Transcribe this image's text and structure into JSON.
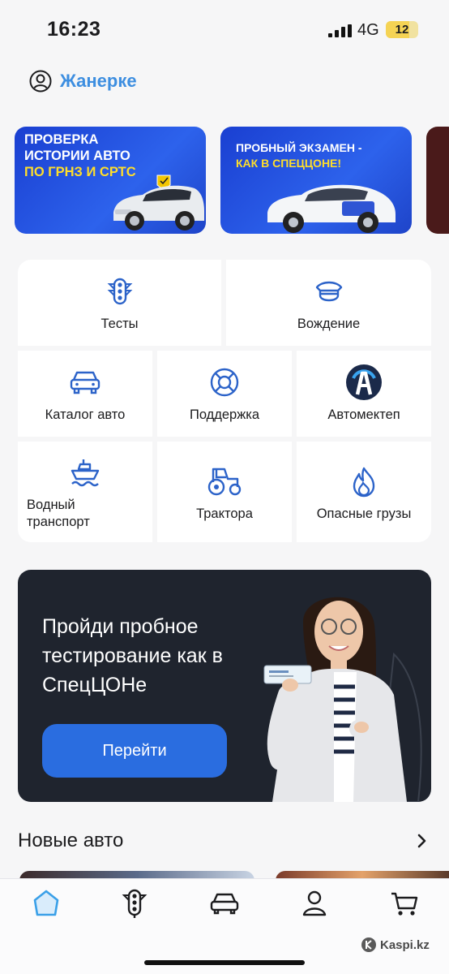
{
  "status_bar": {
    "time": "16:23",
    "network": "4G",
    "battery": "12",
    "battery_level": 0.12
  },
  "user": {
    "name": "Жанерке",
    "icon": "user-circle-icon"
  },
  "banners": [
    {
      "line1": "ПРОВЕРКА",
      "line2": "ИСТОРИИ АВТО",
      "line3": "ПО ГРНЗ И СРТС"
    },
    {
      "line1": "ПРОБНЫЙ ЭКЗАМЕН -",
      "line2": "КАК В СПЕЦЦОНЕ!"
    }
  ],
  "grid": {
    "tests": "Тесты",
    "driving": "Вождение",
    "catalog": "Каталог авто",
    "support": "Поддержка",
    "avtomektep": "Автомектеп",
    "water_line1": "Водный",
    "water_line2": "транспорт",
    "tractors": "Трактора",
    "dangerous": "Опасные грузы"
  },
  "promo": {
    "title": "Пройди пробное тестирование как в СпецЦОНе",
    "button": "Перейти"
  },
  "section": {
    "title": "Новые авто"
  },
  "tabbar": [
    "home-icon",
    "traffic-light-icon",
    "car-icon",
    "profile-icon",
    "cart-icon"
  ],
  "watermark": "Kaspi.kz",
  "colors": {
    "accent": "#2a6de0",
    "icon_blue": "#2c63c9",
    "promo_bg": "#1f242e",
    "banner_blue": "#2d62ec",
    "yellow": "#ffde2a"
  }
}
